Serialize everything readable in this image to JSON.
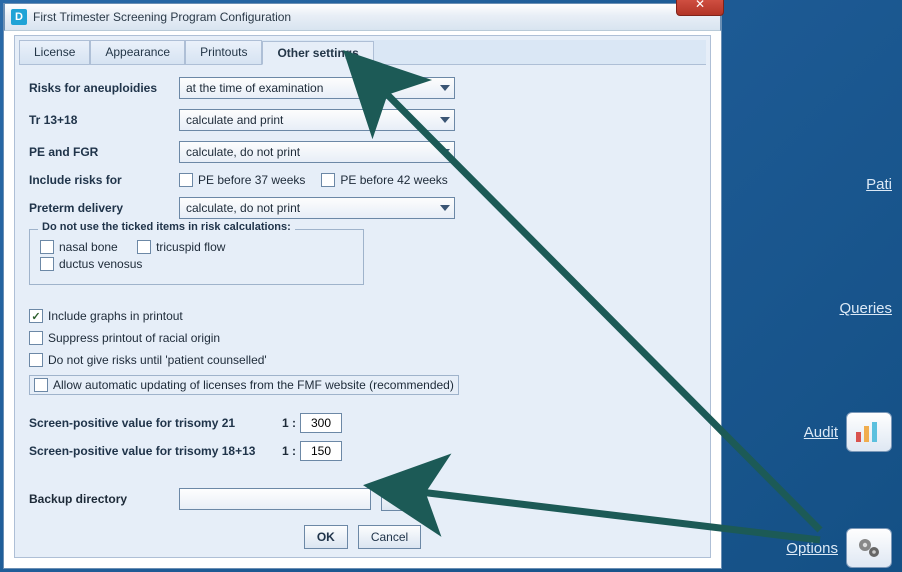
{
  "window": {
    "title": "First Trimester Screening Program Configuration"
  },
  "tabs": {
    "license": "License",
    "appearance": "Appearance",
    "printouts": "Printouts",
    "other": "Other settings"
  },
  "labels": {
    "risks_aneuploidies": "Risks for aneuploidies",
    "tr1318": "Tr 13+18",
    "pefgr": "PE and FGR",
    "include_risks_for": "Include risks for",
    "preterm": "Preterm delivery",
    "group_title": "Do not use the ticked items in risk calculations:",
    "nasal": "nasal bone",
    "tricuspid": "tricuspid flow",
    "ductus": "ductus venosus",
    "pe37": "PE before 37 weeks",
    "pe42": "PE before 42 weeks",
    "graphs": "Include graphs in printout",
    "suppress": "Suppress printout of racial origin",
    "counselled": "Do not give risks until 'patient counselled'",
    "autoupd": "Allow automatic updating of licenses from the FMF website (recommended)",
    "spv21": "Screen-positive value for trisomy 21",
    "spv1813": "Screen-positive value for trisomy 18+13",
    "ratio": "1 :",
    "backup": "Backup directory",
    "browse": "...",
    "ok": "OK",
    "cancel": "Cancel"
  },
  "combos": {
    "risks_aneuploidies": "at the time of examination",
    "tr1318": "calculate and print",
    "pefgr": "calculate, do not print",
    "preterm": "calculate, do not print"
  },
  "values": {
    "spv21": "300",
    "spv1813": "150",
    "backup_dir": ""
  },
  "sidebar": {
    "patients": "Pati",
    "queries": "Queries",
    "audit": "Audit",
    "options": "Options"
  }
}
